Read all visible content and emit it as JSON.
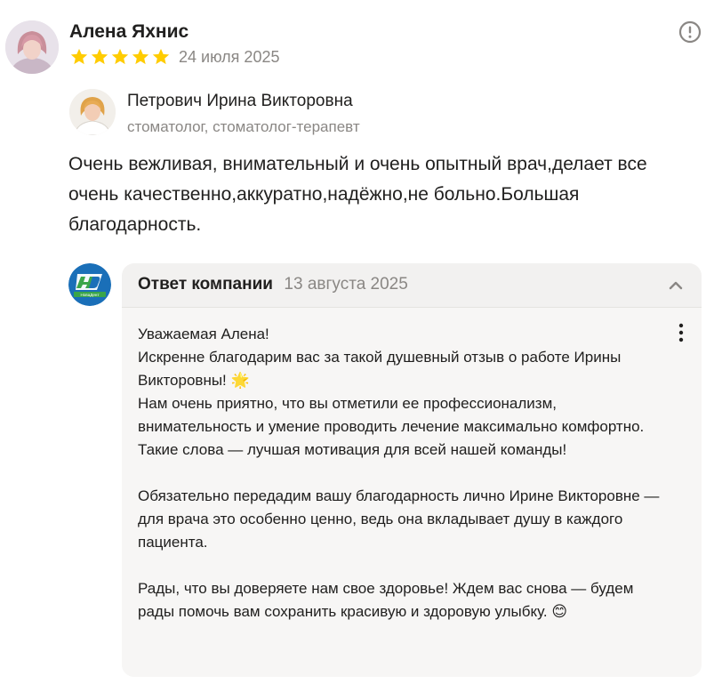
{
  "review": {
    "author_name": "Алена Яхнис",
    "rating": 5,
    "date": "24 июля 2025",
    "text": "Очень вежливая, внимательный и очень опытный врач,делает все очень качественно,аккуратно,надёжно,не больно.Большая благодарность."
  },
  "doctor": {
    "name": "Петрович Ирина Викторовна",
    "specialty": "стоматолог, стоматолог-терапевт"
  },
  "reply": {
    "title": "Ответ компании",
    "date": "13 августа 2025",
    "logo_text": "НоваДент",
    "paragraphs": [
      "Уважаемая Алена!",
      "Искренне благодарим вас за такой душевный отзыв о работе Ирины Викторовны! 🌟",
      "Нам очень приятно, что вы отметили ее профессионализм, внимательность и умение проводить лечение максимально комфортно. Такие слова — лучшая мотивация для всей нашей команды!",
      "Обязательно передадим вашу благодарность лично Ирине Викторовне — для врача это особенно ценно, ведь она вкладывает душу в каждого пациента.",
      "Рады, что вы доверяете нам свое здоровье! Ждем вас снова — будем рады помочь вам сохранить красивую и здоровую улыбку. 😊"
    ]
  },
  "colors": {
    "star": "#fc0",
    "muted_text": "#8a8784",
    "reply_bg": "#f2f1f0",
    "logo_blue": "#1a6fb8",
    "logo_green": "#3aa54a"
  },
  "icons": {
    "more": "info-circle-icon",
    "collapse": "chevron-up-icon",
    "reply_menu": "kebab-menu-icon"
  }
}
